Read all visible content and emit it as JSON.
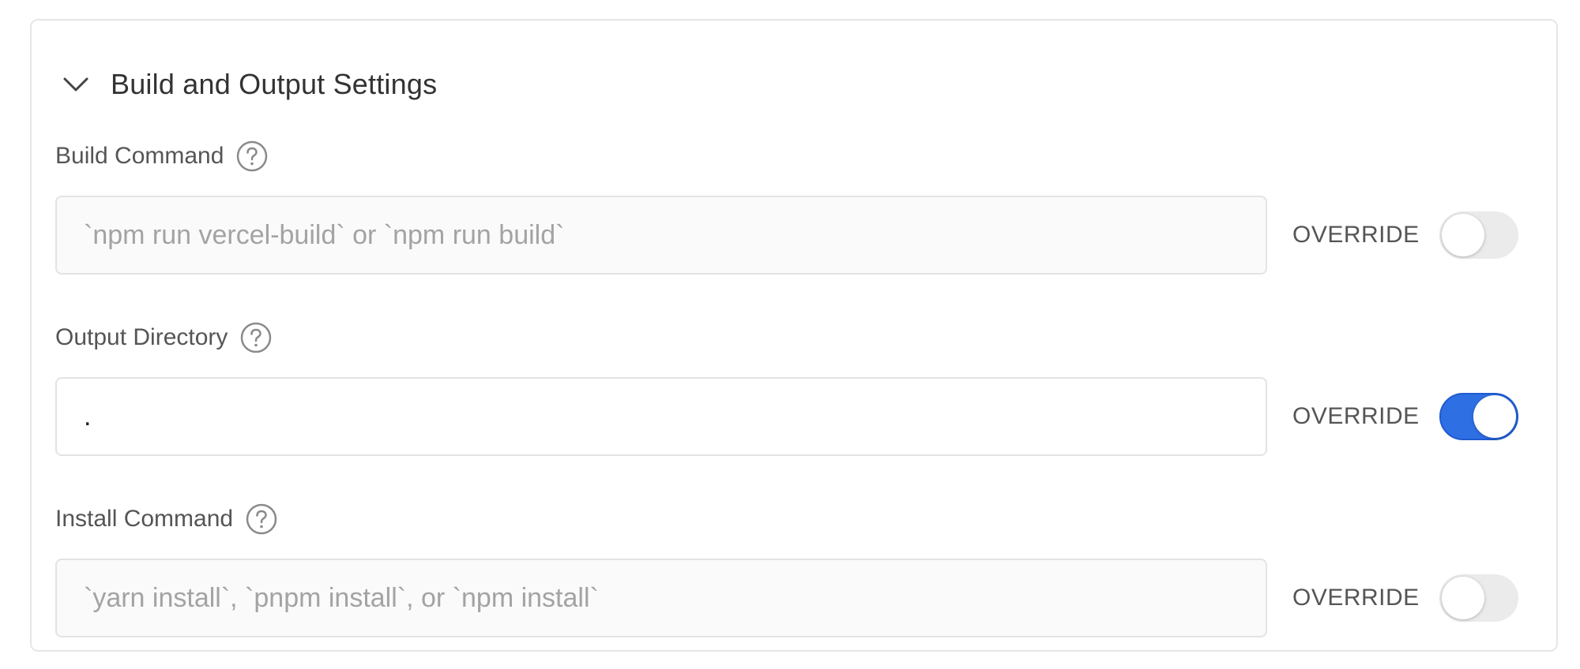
{
  "section": {
    "title": "Build and Output Settings",
    "expanded": true
  },
  "fields": [
    {
      "label": "Build Command",
      "placeholder": "`npm run vercel-build` or `npm run build`",
      "value": "",
      "override_label": "OVERRIDE",
      "override_enabled": false
    },
    {
      "label": "Output Directory",
      "placeholder": "",
      "value": ".",
      "override_label": "OVERRIDE",
      "override_enabled": true
    },
    {
      "label": "Install Command",
      "placeholder": "`yarn install`, `pnpm install`, or `npm install`",
      "value": "",
      "override_label": "OVERRIDE",
      "override_enabled": false
    }
  ],
  "colors": {
    "toggle_on": "#2f6fe4",
    "toggle_off": "#ebebeb",
    "border": "#e6e6e6"
  }
}
